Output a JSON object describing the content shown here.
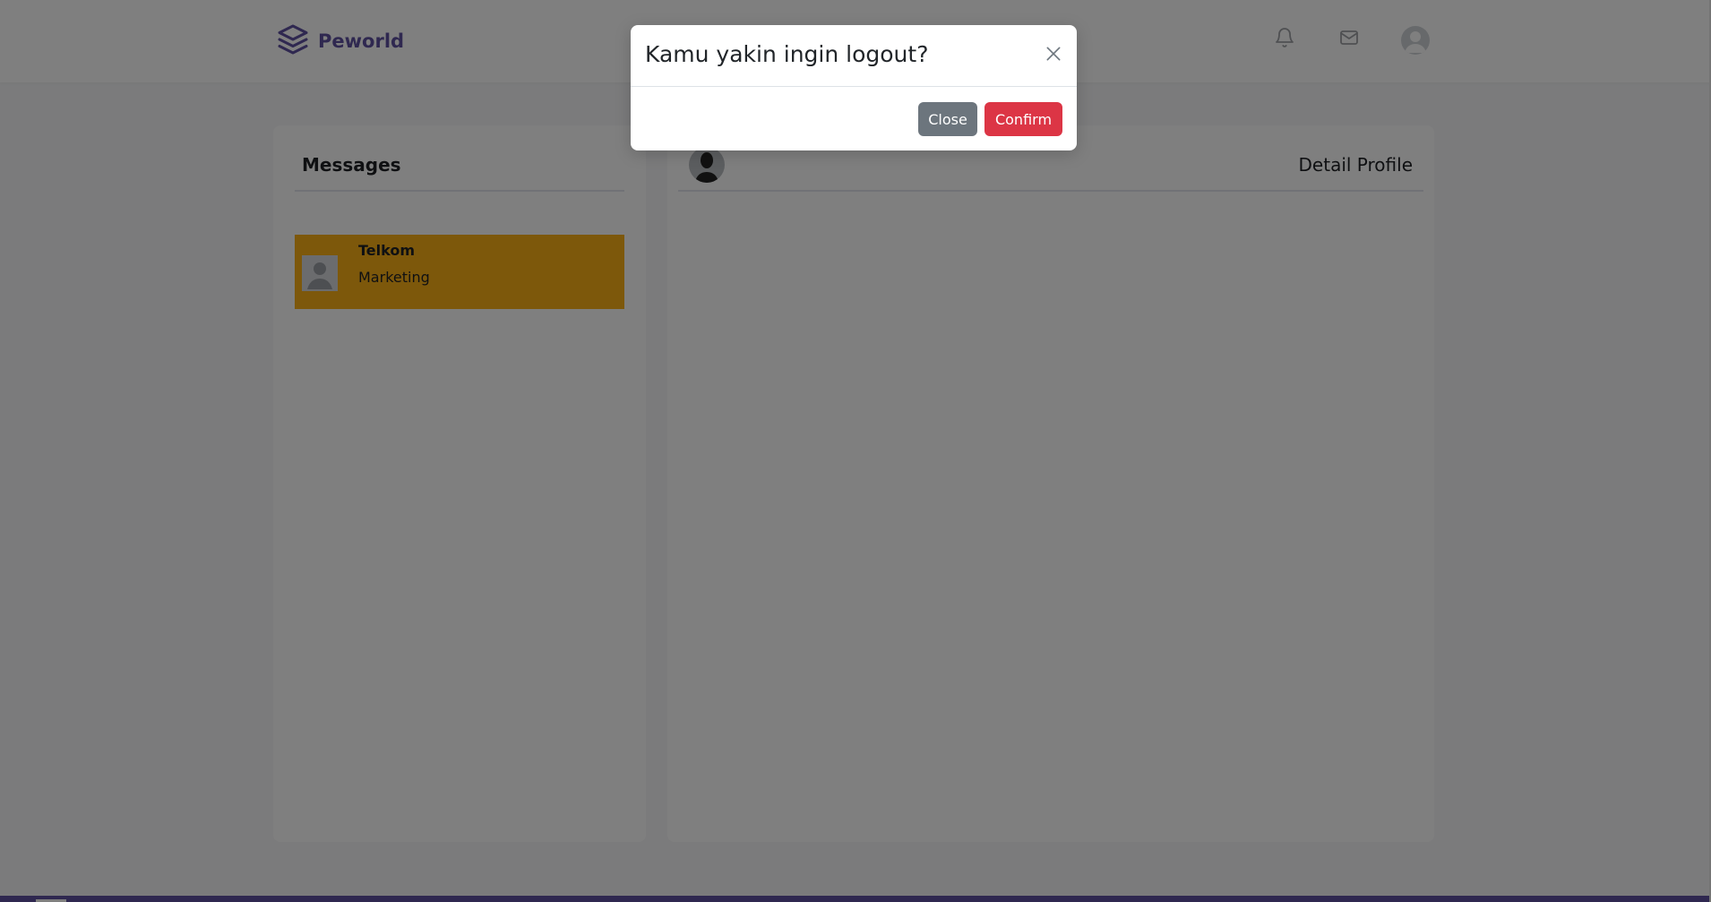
{
  "navbar": {
    "brand_name": "Peworld",
    "icons": [
      "layers-logo-icon",
      "bell-icon",
      "mail-icon",
      "user-avatar-icon"
    ]
  },
  "messages": {
    "title": "Messages",
    "contacts": [
      {
        "name": "Telkom",
        "role": "Marketing",
        "highlight_color": "#fbb017"
      }
    ]
  },
  "detail": {
    "link_label": "Detail Profile"
  },
  "modal": {
    "title": "Kamu yakin ingin logout?",
    "close_label": "Close",
    "confirm_label": "Confirm"
  },
  "colors": {
    "brand": "#5e50a1",
    "highlight": "#fbb017",
    "close_button": "#6c757d",
    "confirm_button": "#dc3545",
    "page_background": "#f6f7f8"
  }
}
